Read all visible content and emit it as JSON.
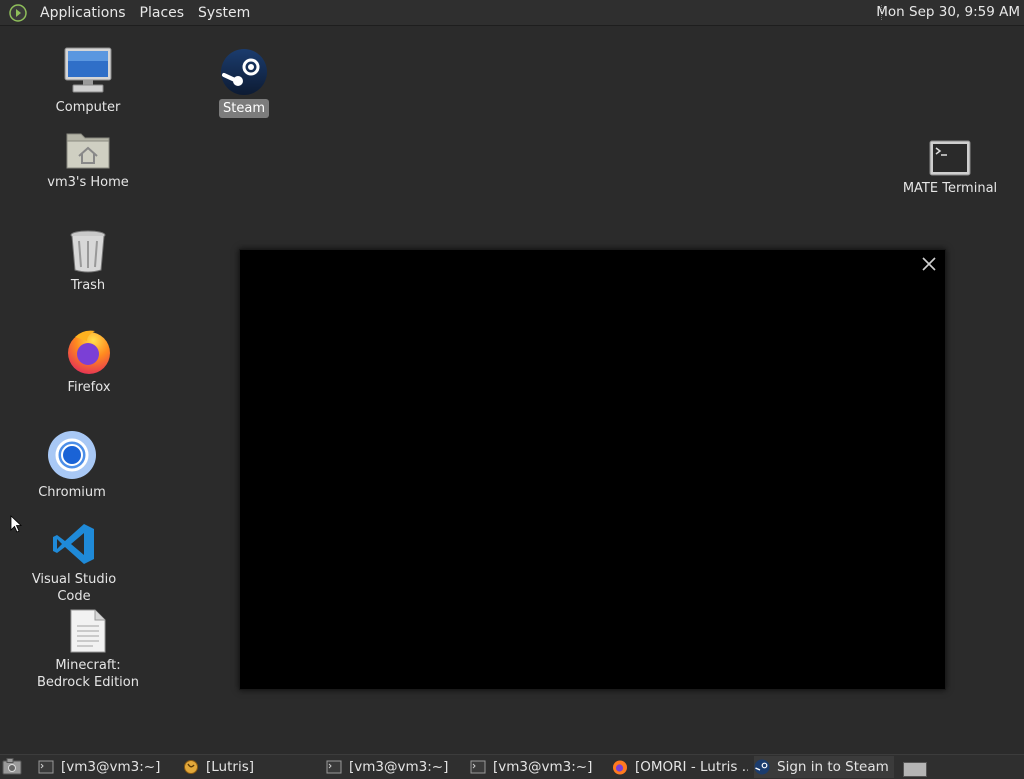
{
  "top_panel": {
    "menus": [
      "Applications",
      "Places",
      "System"
    ],
    "clock": "Mon Sep 30,  9:59 AM"
  },
  "desktop": {
    "icons": [
      {
        "label": "Computer",
        "icon": "computer-icon"
      },
      {
        "label": "vm3's Home",
        "icon": "home-folder-icon"
      },
      {
        "label": "Trash",
        "icon": "trash-icon"
      },
      {
        "label": "Firefox",
        "icon": "firefox-icon"
      },
      {
        "label": "Chromium",
        "icon": "chromium-icon"
      },
      {
        "label": "Visual Studio Code",
        "icon": "vscode-icon"
      },
      {
        "label": "Minecraft: Bedrock Edition",
        "icon": "document-icon"
      },
      {
        "label": "Steam",
        "icon": "steam-icon",
        "selected": true
      },
      {
        "label": "MATE Terminal",
        "icon": "terminal-icon"
      }
    ]
  },
  "taskbar": {
    "tasks": [
      {
        "label": "[vm3@vm3:~]",
        "icon": "terminal-icon"
      },
      {
        "label": "[Lutris]",
        "icon": "lutris-icon"
      },
      {
        "label": "[vm3@vm3:~]",
        "icon": "terminal-icon"
      },
      {
        "label": "[vm3@vm3:~]",
        "icon": "terminal-icon"
      },
      {
        "label": "[OMORI - Lutris ...",
        "icon": "firefox-icon"
      },
      {
        "label": "Sign in to Steam",
        "icon": "steam-icon",
        "active": true
      }
    ]
  },
  "colors": {
    "desktop_bg": "#2b2b2b",
    "panel_bg": "#2f2f2f",
    "window_bg": "#000000",
    "selection_bg": "#7c7c7c"
  }
}
